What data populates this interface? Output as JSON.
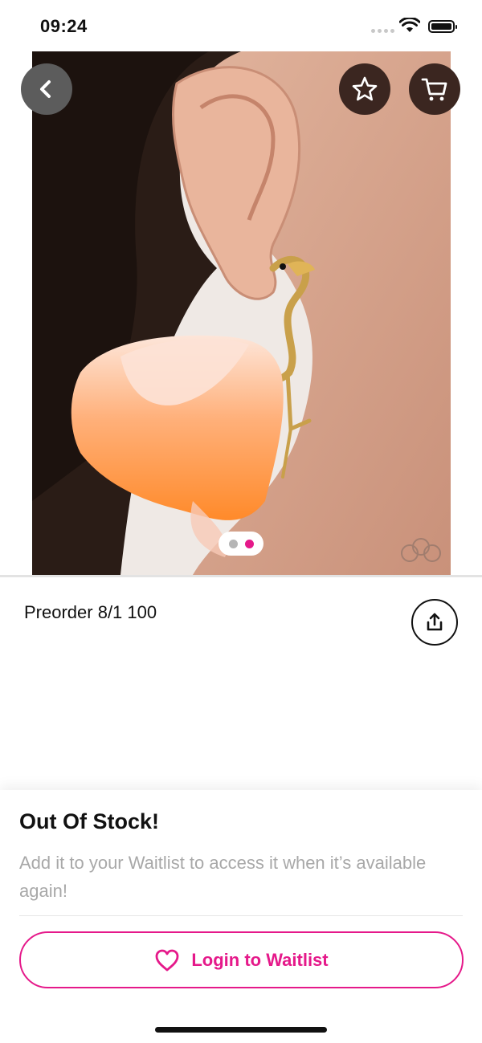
{
  "status_bar": {
    "time": "09:24"
  },
  "product": {
    "title": "Preorder 8/1 100",
    "image_count": 2,
    "active_image_index": 1
  },
  "icons": {
    "back": "chevron-left-icon",
    "favorite": "star-icon",
    "cart": "cart-icon",
    "share": "share-icon",
    "waitlist": "heart-icon"
  },
  "stock": {
    "title": "Out Of Stock!",
    "message": "Add it to your Waitlist to access it when it’s available again!",
    "button_label": "Login to Waitlist"
  },
  "colors": {
    "accent": "#e5198a",
    "header_button_bg": "#3b2620",
    "back_button_bg": "#5c5c5c",
    "pager_inactive": "#b5b5b5"
  }
}
